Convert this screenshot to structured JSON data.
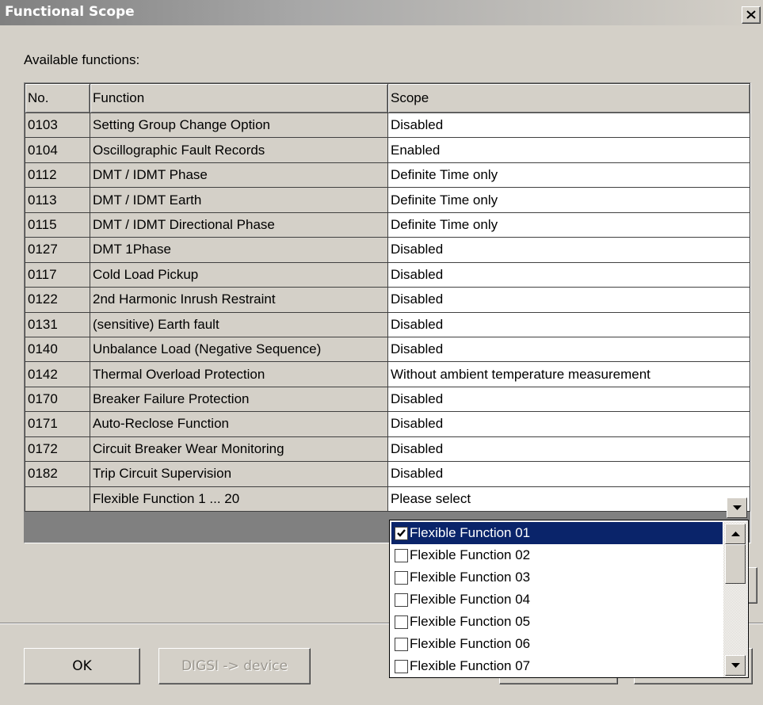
{
  "window": {
    "title": "Functional Scope",
    "close_label": "✕"
  },
  "available_label": "Available functions:",
  "table": {
    "headers": [
      "No.",
      "Function",
      "Scope"
    ],
    "rows": [
      {
        "no": "0103",
        "function": "Setting Group Change Option",
        "scope": "Disabled"
      },
      {
        "no": "0104",
        "function": "Oscillographic Fault Records",
        "scope": "Enabled"
      },
      {
        "no": "0112",
        "function": "DMT / IDMT Phase",
        "scope": "Definite Time only"
      },
      {
        "no": "0113",
        "function": "DMT / IDMT Earth",
        "scope": "Definite Time only"
      },
      {
        "no": "0115",
        "function": "DMT / IDMT Directional Phase",
        "scope": "Definite Time only"
      },
      {
        "no": "0127",
        "function": "DMT 1Phase",
        "scope": "Disabled"
      },
      {
        "no": "0117",
        "function": "Cold Load Pickup",
        "scope": "Disabled"
      },
      {
        "no": "0122",
        "function": "2nd Harmonic Inrush Restraint",
        "scope": "Disabled"
      },
      {
        "no": "0131",
        "function": "(sensitive) Earth fault",
        "scope": "Disabled"
      },
      {
        "no": "0140",
        "function": "Unbalance Load (Negative Sequence)",
        "scope": "Disabled"
      },
      {
        "no": "0142",
        "function": "Thermal Overload Protection",
        "scope": "Without ambient temperature measurement"
      },
      {
        "no": "0170",
        "function": "Breaker Failure Protection",
        "scope": "Disabled"
      },
      {
        "no": "0171",
        "function": "Auto-Reclose Function",
        "scope": "Disabled"
      },
      {
        "no": "0172",
        "function": "Circuit Breaker Wear Monitoring",
        "scope": "Disabled"
      },
      {
        "no": "0182",
        "function": "Trip Circuit Supervision",
        "scope": "Disabled"
      },
      {
        "no": "",
        "function": "Flexible Function 1 ... 20",
        "scope": "Please select"
      }
    ]
  },
  "dropdown": {
    "items": [
      {
        "label": "Flexible Function 01",
        "checked": true,
        "selected": true
      },
      {
        "label": "Flexible Function 02",
        "checked": false,
        "selected": false
      },
      {
        "label": "Flexible Function 03",
        "checked": false,
        "selected": false
      },
      {
        "label": "Flexible Function 04",
        "checked": false,
        "selected": false
      },
      {
        "label": "Flexible Function 05",
        "checked": false,
        "selected": false
      },
      {
        "label": "Flexible Function 06",
        "checked": false,
        "selected": false
      },
      {
        "label": "Flexible Function 07",
        "checked": false,
        "selected": false
      }
    ]
  },
  "buttons": {
    "ok": "OK",
    "digsi": "DIGSI -> device"
  },
  "colors": {
    "dialog_bg": "#d4d0c8",
    "selection": "#0a246a",
    "title_gradient_start": "#808080"
  }
}
